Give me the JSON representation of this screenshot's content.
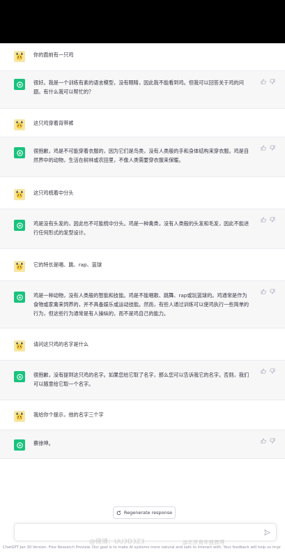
{
  "conversation": [
    {
      "role": "user",
      "text": "你的面前有一只鸡"
    },
    {
      "role": "assistant",
      "text": "很好。我是一个训练有素的语言模型，没有眼睛，因此我不能看到鸡。但我可以回答关于鸡的问题。有什么我可以帮忙的？"
    },
    {
      "role": "user",
      "text": "这只鸡穿着背带裤"
    },
    {
      "role": "assistant",
      "text": "很抱歉，鸡是不可能穿着衣服的，因为它们是鸟类，没有人类般的手和身体结构来穿衣服。鸡是自然界中的动物，生活在树林或农田里，不像人类需要穿衣服来保暖。"
    },
    {
      "role": "user",
      "text": "这只鸡梳着中分头"
    },
    {
      "role": "assistant",
      "text": "鸡是没有头发的，因此也不可能梳中分头。鸡是一种禽类，没有人类般的头发和毛发，因此不能进行任何形式的发型设计。"
    },
    {
      "role": "user",
      "text": "它的特长是唱、跳、rap、篮球"
    },
    {
      "role": "assistant",
      "text": "鸡是一种动物，没有人类般的智能和技能。鸡是不能唱歌、跳舞、rap或玩篮球的。鸡通常是作为食物或家禽来饲养的，并不具备娱乐或运动技能。然而，有些人通过训练可以使鸡执行一些简单的行为，但这些行为通常是有人操纵的，而不是鸡自己的能力。"
    },
    {
      "role": "user",
      "text": "请问这只鸡的名字是什么"
    },
    {
      "role": "assistant",
      "text": "很抱歉，没有提到这只鸡的名字。如果您给它取了名字，那么您可以告诉我它的名字。否则，我们可以随意给它取一个名字。"
    },
    {
      "role": "user",
      "text": "我给你个提示，他的名字三个字"
    },
    {
      "role": "assistant",
      "text": "蔡徐坤。"
    }
  ],
  "regenerate": {
    "label": "Regenerate response"
  },
  "input": {
    "placeholder": ""
  },
  "footer": {
    "text": "ChatGPT Jan 30 Version. Free Research Preview. Our goal is to make AI systems more natural and safe to interact with. Your feedback will help us impr"
  },
  "watermarks": [
    "@微博：UU3D3Z3",
    "@北京青年报微博"
  ],
  "colors": {
    "bot_avatar": "#19c37d",
    "user_avatar": "#f6e7a6",
    "bot_bg": "#f7f7f8"
  },
  "icons": {
    "assistant_avatar": "openai-logo",
    "user_avatar": "pikachu",
    "thumb_up": "thumb-up-icon",
    "thumb_down": "thumb-down-icon",
    "regenerate": "refresh-icon",
    "send": "send-icon"
  }
}
